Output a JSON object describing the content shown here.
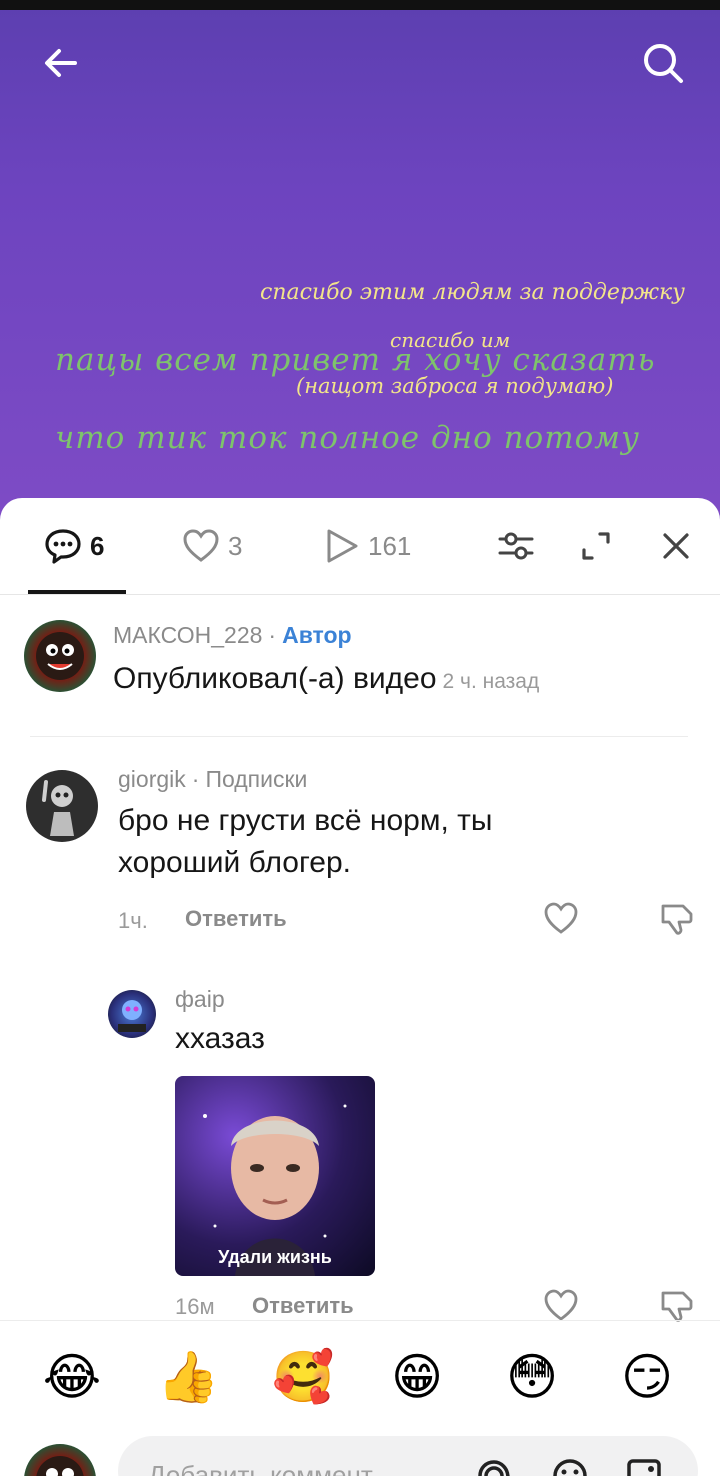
{
  "video": {
    "overlay_lines": [
      "спасибо этим людям за поддержку",
      "спасибо им",
      "пацы всем привет я хочу сказать",
      "(нащот заброса я подумаю)",
      "что тик ток полное дно потому"
    ]
  },
  "tabs": {
    "comments_count": "6",
    "likes_count": "3",
    "views_count": "161"
  },
  "comments": {
    "author_post": {
      "username": "МАКСОН_228",
      "badge": "Автор",
      "text": "Опубликовал(-а) видео",
      "time": "2 ч. назад"
    },
    "first": {
      "username": "giorgik",
      "relation": "Подписки",
      "text": "бро не грусти всё норм, ты хороший блогер.",
      "time": "1ч.",
      "reply_label": "Ответить"
    },
    "reply": {
      "username": "фаір",
      "text": "ххазаз",
      "sticker_caption": "Удали жизнь",
      "time": "16м",
      "reply_label": "Ответить"
    }
  },
  "emoji_bar": [
    "😂",
    "👍",
    "🥰",
    "😁",
    "😳",
    "😏"
  ],
  "input": {
    "placeholder": "Добавить коммент..."
  },
  "colors": {
    "video_bg": "#6d44bf",
    "author_badge": "#3b82d6",
    "overlay_yellow": "#f3e58a",
    "overlay_green": "#7ec46b"
  }
}
